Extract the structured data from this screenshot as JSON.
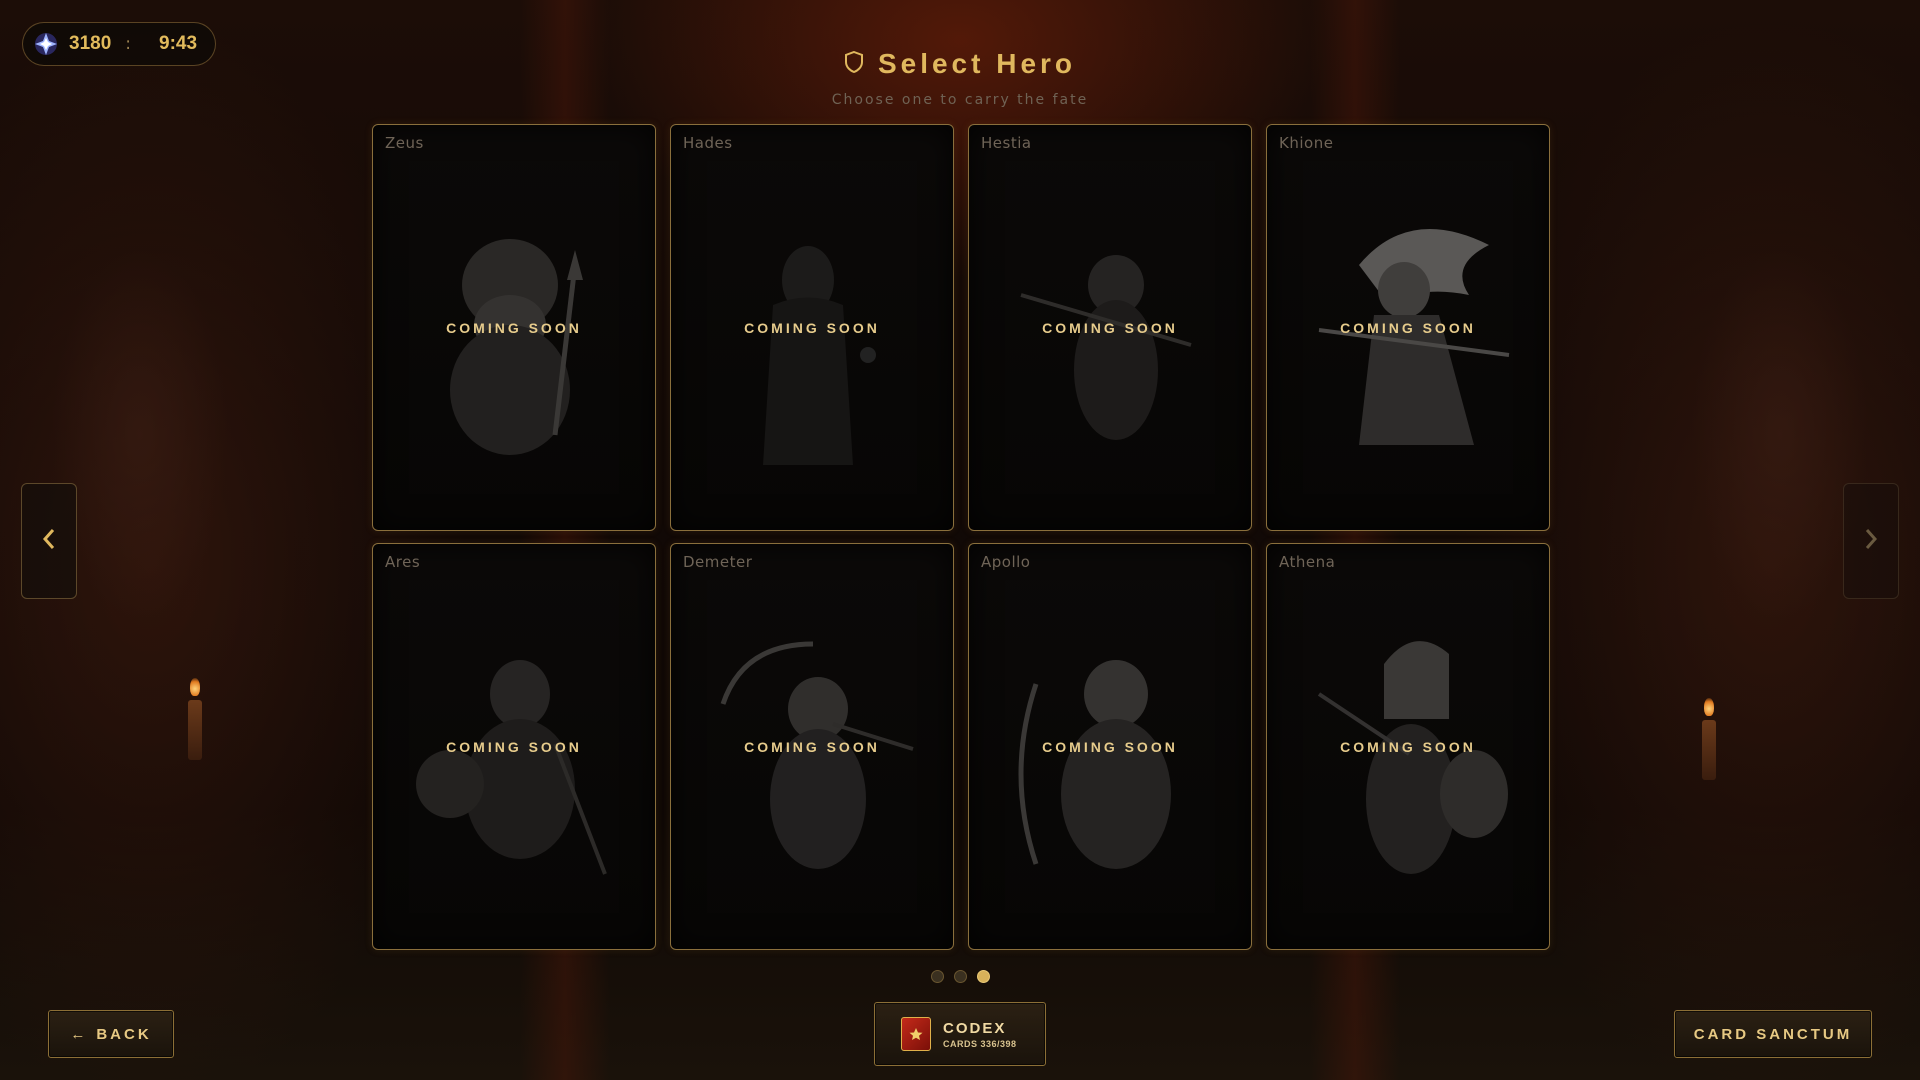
{
  "hud": {
    "gems": "3180",
    "separator": ":",
    "time": "9:43",
    "gem_icon": "crystal-gem-icon"
  },
  "header": {
    "title": "Select Hero",
    "subtitle": "Choose one to carry the fate",
    "title_icon": "shield-icon"
  },
  "heroes": [
    {
      "name": "Zeus",
      "status": "COMING SOON",
      "icon": "zeus-portrait"
    },
    {
      "name": "Hades",
      "status": "COMING SOON",
      "icon": "hades-portrait"
    },
    {
      "name": "Hestia",
      "status": "COMING SOON",
      "icon": "hestia-portrait"
    },
    {
      "name": "Khione",
      "status": "COMING SOON",
      "icon": "khione-portrait"
    },
    {
      "name": "Ares",
      "status": "COMING SOON",
      "icon": "ares-portrait"
    },
    {
      "name": "Demeter",
      "status": "COMING SOON",
      "icon": "demeter-portrait"
    },
    {
      "name": "Apollo",
      "status": "COMING SOON",
      "icon": "apollo-portrait"
    },
    {
      "name": "Athena",
      "status": "COMING SOON",
      "icon": "athena-portrait"
    }
  ],
  "pagination": {
    "total": 3,
    "current": 3
  },
  "buttons": {
    "back": "BACK",
    "back_arrow": "←",
    "codex_title": "CODEX",
    "codex_sub": "CARDS 336/398",
    "sanctum": "CARD SANCTUM"
  },
  "colors": {
    "accent_gold": "#d8b25a",
    "card_border": "#8a6f3c",
    "background": "#120906"
  }
}
